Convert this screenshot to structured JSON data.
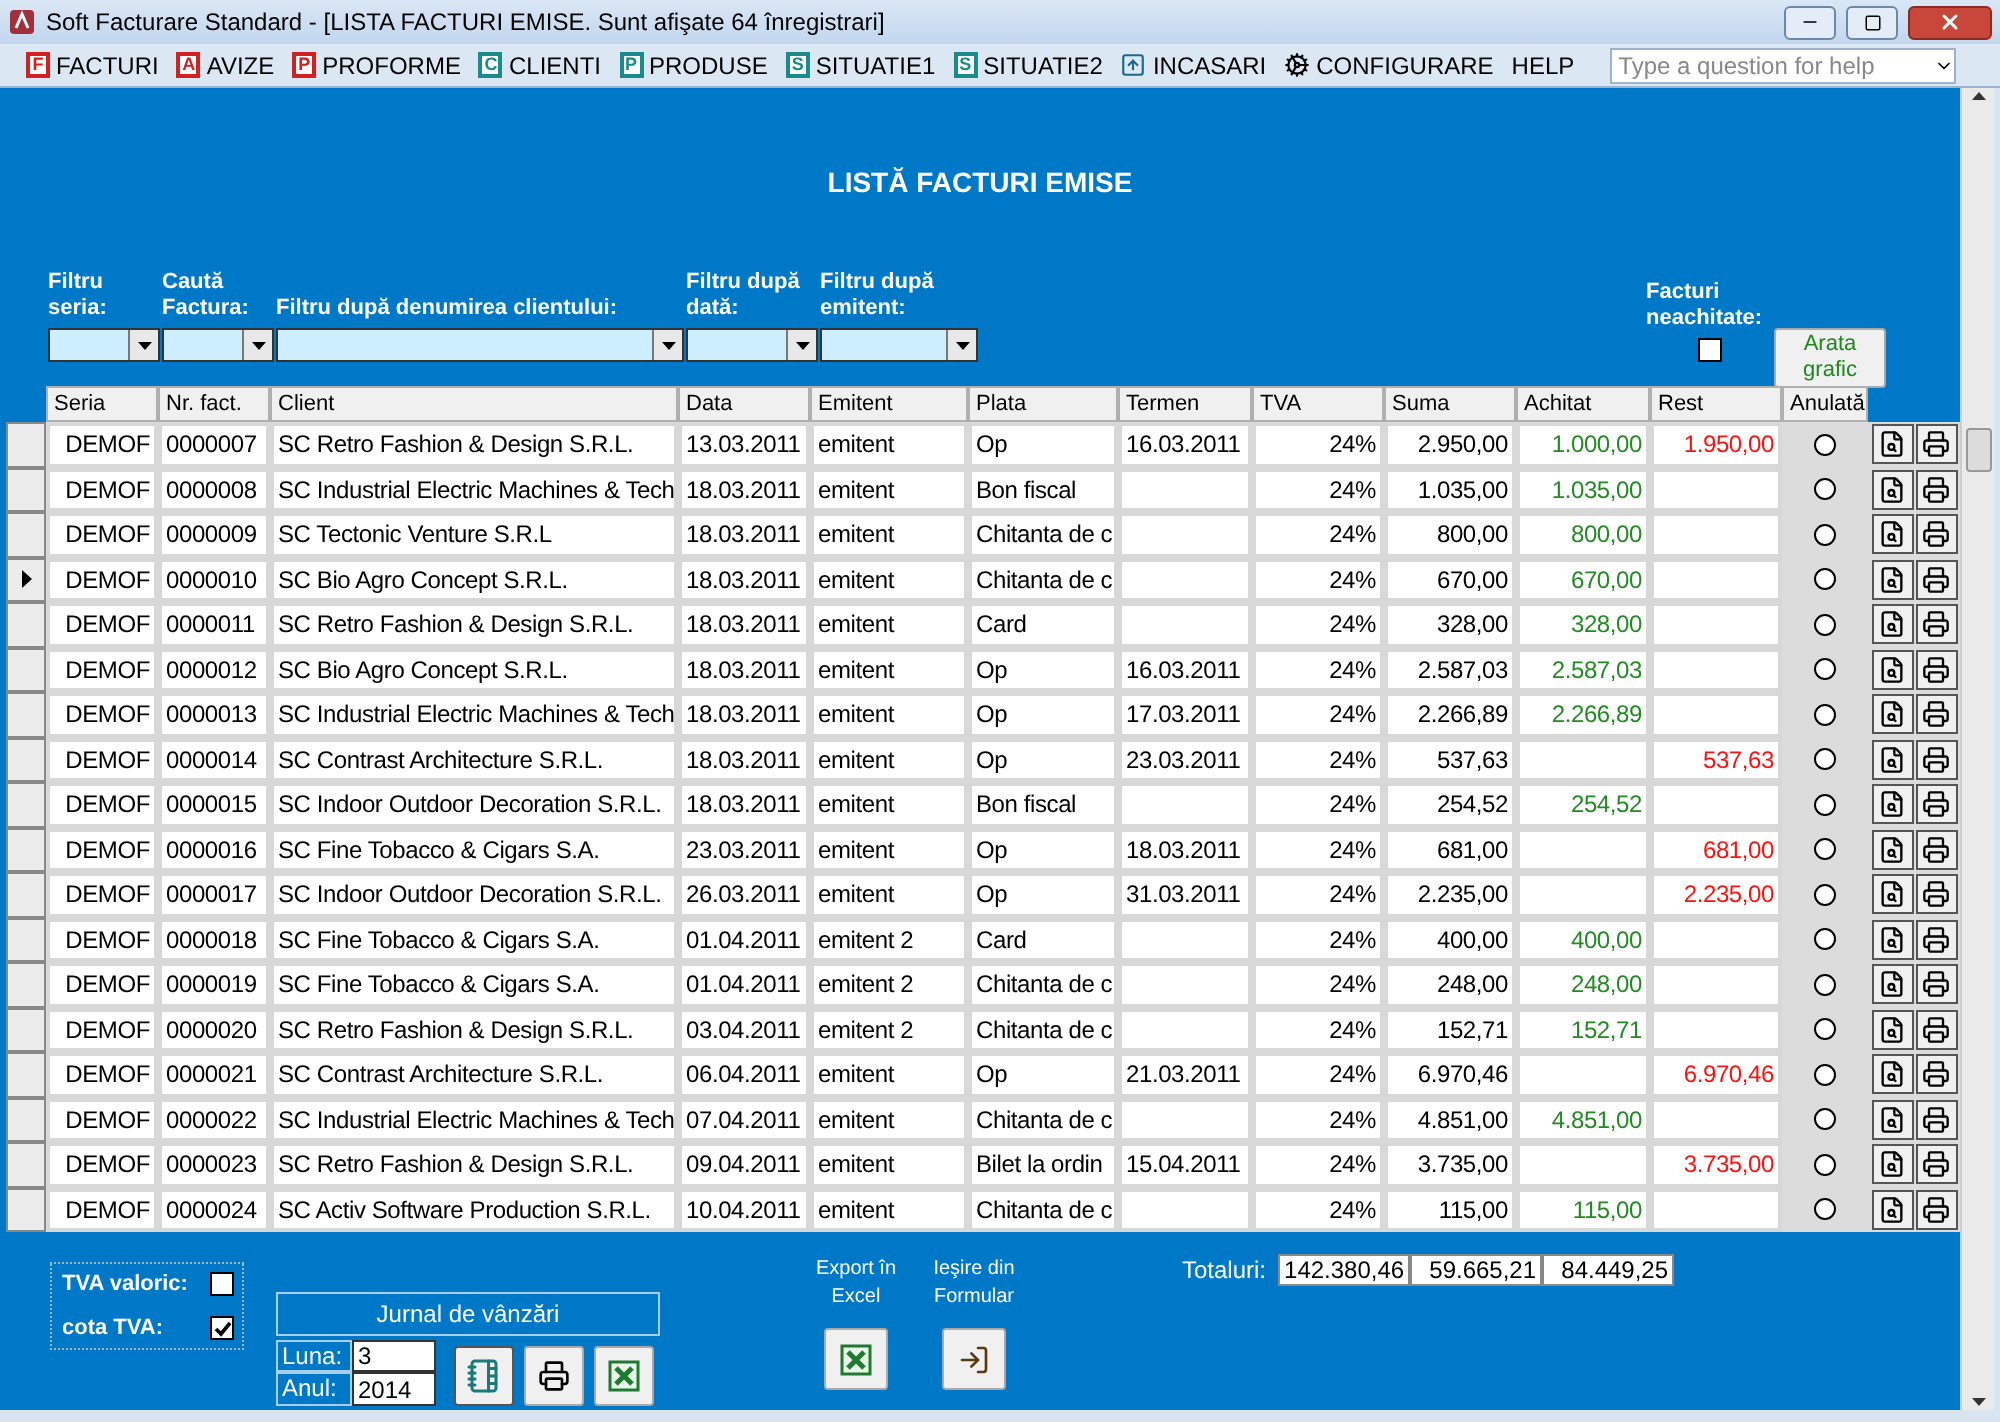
{
  "window": {
    "title": "Soft Facturare Standard - [LISTA FACTURI EMISE. Sunt afişate 64 înregistrari]"
  },
  "menu": [
    {
      "label": "FACTURI",
      "badge": "F",
      "color": "#d42020"
    },
    {
      "label": "AVIZE",
      "badge": "A",
      "color": "#d42020"
    },
    {
      "label": "PROFORME",
      "badge": "P",
      "color": "#d42020"
    },
    {
      "label": "CLIENTI",
      "badge": "C",
      "color": "#1a8a8a"
    },
    {
      "label": "PRODUSE",
      "badge": "P",
      "color": "#1a8a8a"
    },
    {
      "label": "SITUATIE1",
      "badge": "S",
      "color": "#1a8a8a"
    },
    {
      "label": "SITUATIE2",
      "badge": "S",
      "color": "#1a8a8a"
    },
    {
      "label": "INCASARI",
      "kind": "arrow"
    },
    {
      "label": "CONFIGURARE",
      "kind": "gear"
    },
    {
      "label": "HELP",
      "kind": "plain"
    }
  ],
  "help_search": {
    "placeholder": "Type a question for help"
  },
  "heading": "LISTĂ FACTURI EMISE",
  "filters": [
    {
      "label": "Filtru seria:",
      "kind": "seria"
    },
    {
      "label": "Caută Factura:",
      "kind": "factura"
    },
    {
      "label": "Filtru după denumirea clientului:",
      "kind": "client"
    },
    {
      "label": "Filtru după dată:",
      "kind": "data"
    },
    {
      "label": "Filtru după emitent:",
      "kind": "emitent"
    }
  ],
  "unpaid_filter": {
    "label": "Facturi neachitate:",
    "checked": false
  },
  "chart_button": "Arata grafic",
  "table": {
    "columns": [
      "Seria",
      "Nr. fact.",
      "Client",
      "Data",
      "Emitent",
      "Plata",
      "Termen",
      "TVA",
      "Suma",
      "Achitat",
      "Rest",
      "Anulată"
    ],
    "rows": [
      {
        "seria": "DEMOF",
        "nr": "0000007",
        "client": "SC Retro Fashion & Design S.R.L.",
        "data": "13.03.2011",
        "emitent": "emitent",
        "plata": "Op",
        "termen": "16.03.2011",
        "tva": "24%",
        "suma": "2.950,00",
        "achitat": "1.000,00",
        "rest": "1.950,00",
        "anulata": false,
        "selected": false
      },
      {
        "seria": "DEMOF",
        "nr": "0000008",
        "client": "SC Industrial Electric Machines & Tech",
        "data": "18.03.2011",
        "emitent": "emitent",
        "plata": "Bon fiscal",
        "tva": "24%",
        "suma": "1.035,00",
        "achitat": "1.035,00",
        "anulata": false,
        "selected": false
      },
      {
        "seria": "DEMOF",
        "nr": "0000009",
        "client": "SC Tectonic Venture S.R.L",
        "data": "18.03.2011",
        "emitent": "emitent",
        "plata": "Chitanta de c",
        "tva": "24%",
        "suma": "800,00",
        "achitat": "800,00",
        "anulata": false,
        "selected": false
      },
      {
        "seria": "DEMOF",
        "nr": "0000010",
        "client": "SC Bio Agro Concept S.R.L.",
        "data": "18.03.2011",
        "emitent": "emitent",
        "plata": "Chitanta de c",
        "tva": "24%",
        "suma": "670,00",
        "achitat": "670,00",
        "anulata": false,
        "selected": true
      },
      {
        "seria": "DEMOF",
        "nr": "0000011",
        "client": "SC Retro Fashion & Design S.R.L.",
        "data": "18.03.2011",
        "emitent": "emitent",
        "plata": "Card",
        "tva": "24%",
        "suma": "328,00",
        "achitat": "328,00",
        "anulata": false,
        "selected": false
      },
      {
        "seria": "DEMOF",
        "nr": "0000012",
        "client": "SC Bio Agro Concept S.R.L.",
        "data": "18.03.2011",
        "emitent": "emitent",
        "plata": "Op",
        "termen": "16.03.2011",
        "tva": "24%",
        "suma": "2.587,03",
        "achitat": "2.587,03",
        "anulata": false,
        "selected": false
      },
      {
        "seria": "DEMOF",
        "nr": "0000013",
        "client": "SC Industrial Electric Machines & Tech",
        "data": "18.03.2011",
        "emitent": "emitent",
        "plata": "Op",
        "termen": "17.03.2011",
        "tva": "24%",
        "suma": "2.266,89",
        "achitat": "2.266,89",
        "anulata": false,
        "selected": false
      },
      {
        "seria": "DEMOF",
        "nr": "0000014",
        "client": "SC Contrast Architecture S.R.L.",
        "data": "18.03.2011",
        "emitent": "emitent",
        "plata": "Op",
        "termen": "23.03.2011",
        "tva": "24%",
        "suma": "537,63",
        "rest": "537,63",
        "anulata": false,
        "selected": false
      },
      {
        "seria": "DEMOF",
        "nr": "0000015",
        "client": "SC Indoor Outdoor Decoration S.R.L.",
        "data": "18.03.2011",
        "emitent": "emitent",
        "plata": "Bon fiscal",
        "tva": "24%",
        "suma": "254,52",
        "achitat": "254,52",
        "anulata": false,
        "selected": false
      },
      {
        "seria": "DEMOF",
        "nr": "0000016",
        "client": "SC Fine Tobacco & Cigars S.A.",
        "data": "23.03.2011",
        "emitent": "emitent",
        "plata": "Op",
        "termen": "18.03.2011",
        "tva": "24%",
        "suma": "681,00",
        "rest": "681,00",
        "anulata": false,
        "selected": false
      },
      {
        "seria": "DEMOF",
        "nr": "0000017",
        "client": "SC Indoor Outdoor Decoration S.R.L.",
        "data": "26.03.2011",
        "emitent": "emitent",
        "plata": "Op",
        "termen": "31.03.2011",
        "tva": "24%",
        "suma": "2.235,00",
        "rest": "2.235,00",
        "anulata": false,
        "selected": false
      },
      {
        "seria": "DEMOF",
        "nr": "0000018",
        "client": "SC Fine Tobacco & Cigars S.A.",
        "data": "01.04.2011",
        "emitent": "emitent 2",
        "plata": "Card",
        "tva": "24%",
        "suma": "400,00",
        "achitat": "400,00",
        "anulata": false,
        "selected": false
      },
      {
        "seria": "DEMOF",
        "nr": "0000019",
        "client": "SC Fine Tobacco & Cigars S.A.",
        "data": "01.04.2011",
        "emitent": "emitent 2",
        "plata": "Chitanta de c",
        "tva": "24%",
        "suma": "248,00",
        "achitat": "248,00",
        "anulata": false,
        "selected": false
      },
      {
        "seria": "DEMOF",
        "nr": "0000020",
        "client": "SC Retro Fashion & Design S.R.L.",
        "data": "03.04.2011",
        "emitent": "emitent 2",
        "plata": "Chitanta de c",
        "tva": "24%",
        "suma": "152,71",
        "achitat": "152,71",
        "anulata": false,
        "selected": false
      },
      {
        "seria": "DEMOF",
        "nr": "0000021",
        "client": "SC Contrast Architecture S.R.L.",
        "data": "06.04.2011",
        "emitent": "emitent",
        "plata": "Op",
        "termen": "21.03.2011",
        "tva": "24%",
        "suma": "6.970,46",
        "rest": "6.970,46",
        "anulata": false,
        "selected": false
      },
      {
        "seria": "DEMOF",
        "nr": "0000022",
        "client": "SC Industrial Electric Machines & Tech",
        "data": "07.04.2011",
        "emitent": "emitent",
        "plata": "Chitanta de c",
        "tva": "24%",
        "suma": "4.851,00",
        "achitat": "4.851,00",
        "anulata": false,
        "selected": false
      },
      {
        "seria": "DEMOF",
        "nr": "0000023",
        "client": "SC Retro Fashion & Design S.R.L.",
        "data": "09.04.2011",
        "emitent": "emitent",
        "plata": "Bilet la ordin",
        "termen": "15.04.2011",
        "tva": "24%",
        "suma": "3.735,00",
        "rest": "3.735,00",
        "anulata": false,
        "selected": false
      },
      {
        "seria": "DEMOF",
        "nr": "0000024",
        "client": "SC Activ Software Production S.R.L.",
        "data": "10.04.2011",
        "emitent": "emitent",
        "plata": "Chitanta de c",
        "tva": "24%",
        "suma": "115,00",
        "achitat": "115,00",
        "anulata": false,
        "selected": false
      }
    ]
  },
  "footer": {
    "tva_valoric": {
      "label": "TVA valoric:",
      "checked": false
    },
    "cota_tva": {
      "label": "cota TVA:",
      "checked": true
    },
    "journal": {
      "title": "Jurnal de vânzări",
      "month_label": "Luna:",
      "month": "3",
      "year_label": "Anul:",
      "year": "2014"
    },
    "export_label": "Export în Excel",
    "exit_label": "Ieşire din Formular",
    "totals_label": "Totaluri:",
    "totals": [
      "142.380,46",
      "59.665,21",
      "84.449,25"
    ]
  }
}
